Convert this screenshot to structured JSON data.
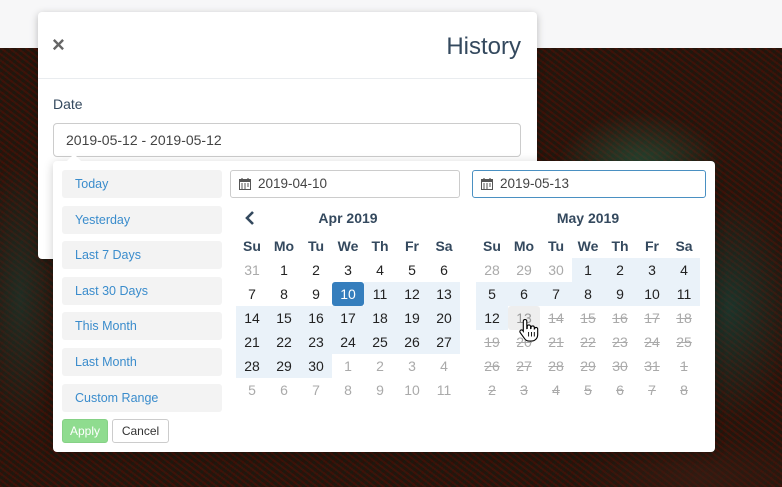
{
  "modal": {
    "close_glyph": "×",
    "title": "History",
    "date_label": "Date",
    "date_value": "2019-05-12 - 2019-05-12"
  },
  "picker": {
    "ranges": [
      "Today",
      "Yesterday",
      "Last 7 Days",
      "Last 30 Days",
      "This Month",
      "Last Month",
      "Custom Range"
    ],
    "apply_label": "Apply",
    "cancel_label": "Cancel",
    "start_input": "2019-04-10",
    "end_input": "2019-05-13",
    "weekdays": [
      "Su",
      "Mo",
      "Tu",
      "We",
      "Th",
      "Fr",
      "Sa"
    ],
    "left_calendar": {
      "title": "Apr 2019",
      "weeks": [
        [
          {
            "d": "31",
            "s": "off"
          },
          {
            "d": "1",
            "s": "in"
          },
          {
            "d": "2",
            "s": "in"
          },
          {
            "d": "3",
            "s": "in"
          },
          {
            "d": "4",
            "s": "in"
          },
          {
            "d": "5",
            "s": "in"
          },
          {
            "d": "6",
            "s": "in"
          }
        ],
        [
          {
            "d": "7",
            "s": "in"
          },
          {
            "d": "8",
            "s": "in"
          },
          {
            "d": "9",
            "s": "in"
          },
          {
            "d": "10",
            "s": "active"
          },
          {
            "d": "11",
            "s": "range"
          },
          {
            "d": "12",
            "s": "range"
          },
          {
            "d": "13",
            "s": "range"
          }
        ],
        [
          {
            "d": "14",
            "s": "range"
          },
          {
            "d": "15",
            "s": "range"
          },
          {
            "d": "16",
            "s": "range"
          },
          {
            "d": "17",
            "s": "range"
          },
          {
            "d": "18",
            "s": "range"
          },
          {
            "d": "19",
            "s": "range"
          },
          {
            "d": "20",
            "s": "range"
          }
        ],
        [
          {
            "d": "21",
            "s": "range"
          },
          {
            "d": "22",
            "s": "range"
          },
          {
            "d": "23",
            "s": "range"
          },
          {
            "d": "24",
            "s": "range"
          },
          {
            "d": "25",
            "s": "range"
          },
          {
            "d": "26",
            "s": "range"
          },
          {
            "d": "27",
            "s": "range"
          }
        ],
        [
          {
            "d": "28",
            "s": "range"
          },
          {
            "d": "29",
            "s": "range"
          },
          {
            "d": "30",
            "s": "range"
          },
          {
            "d": "1",
            "s": "off"
          },
          {
            "d": "2",
            "s": "off"
          },
          {
            "d": "3",
            "s": "off"
          },
          {
            "d": "4",
            "s": "off"
          }
        ],
        [
          {
            "d": "5",
            "s": "off"
          },
          {
            "d": "6",
            "s": "off"
          },
          {
            "d": "7",
            "s": "off"
          },
          {
            "d": "8",
            "s": "off"
          },
          {
            "d": "9",
            "s": "off"
          },
          {
            "d": "10",
            "s": "off"
          },
          {
            "d": "11",
            "s": "off"
          }
        ]
      ]
    },
    "right_calendar": {
      "title": "May 2019",
      "weeks": [
        [
          {
            "d": "28",
            "s": "off"
          },
          {
            "d": "29",
            "s": "off"
          },
          {
            "d": "30",
            "s": "off"
          },
          {
            "d": "1",
            "s": "range"
          },
          {
            "d": "2",
            "s": "range"
          },
          {
            "d": "3",
            "s": "range"
          },
          {
            "d": "4",
            "s": "range"
          }
        ],
        [
          {
            "d": "5",
            "s": "range"
          },
          {
            "d": "6",
            "s": "range"
          },
          {
            "d": "7",
            "s": "range"
          },
          {
            "d": "8",
            "s": "range"
          },
          {
            "d": "9",
            "s": "range"
          },
          {
            "d": "10",
            "s": "range"
          },
          {
            "d": "11",
            "s": "range"
          }
        ],
        [
          {
            "d": "12",
            "s": "range"
          },
          {
            "d": "13",
            "s": "hover"
          },
          {
            "d": "14",
            "s": "disabled"
          },
          {
            "d": "15",
            "s": "disabled"
          },
          {
            "d": "16",
            "s": "disabled"
          },
          {
            "d": "17",
            "s": "disabled"
          },
          {
            "d": "18",
            "s": "disabled"
          }
        ],
        [
          {
            "d": "19",
            "s": "disabled"
          },
          {
            "d": "20",
            "s": "disabled"
          },
          {
            "d": "21",
            "s": "disabled"
          },
          {
            "d": "22",
            "s": "disabled"
          },
          {
            "d": "23",
            "s": "disabled"
          },
          {
            "d": "24",
            "s": "disabled"
          },
          {
            "d": "25",
            "s": "disabled"
          }
        ],
        [
          {
            "d": "26",
            "s": "disabled"
          },
          {
            "d": "27",
            "s": "disabled"
          },
          {
            "d": "28",
            "s": "disabled"
          },
          {
            "d": "29",
            "s": "disabled"
          },
          {
            "d": "30",
            "s": "disabled"
          },
          {
            "d": "31",
            "s": "disabled"
          },
          {
            "d": "1",
            "s": "disabled"
          }
        ],
        [
          {
            "d": "2",
            "s": "disabled"
          },
          {
            "d": "3",
            "s": "disabled"
          },
          {
            "d": "4",
            "s": "disabled"
          },
          {
            "d": "5",
            "s": "disabled"
          },
          {
            "d": "6",
            "s": "disabled"
          },
          {
            "d": "7",
            "s": "disabled"
          },
          {
            "d": "8",
            "s": "disabled"
          }
        ]
      ]
    }
  },
  "icons": {
    "close": "close-icon",
    "calendar": "calendar-icon",
    "prev": "chevron-left-icon",
    "cursor": "hand-pointer-icon"
  },
  "colors": {
    "accent": "#357ebd",
    "range_bg": "#eaf2f9",
    "link": "#3a8ccc",
    "apply_bg": "#8fdc8f",
    "title": "#34495e"
  }
}
